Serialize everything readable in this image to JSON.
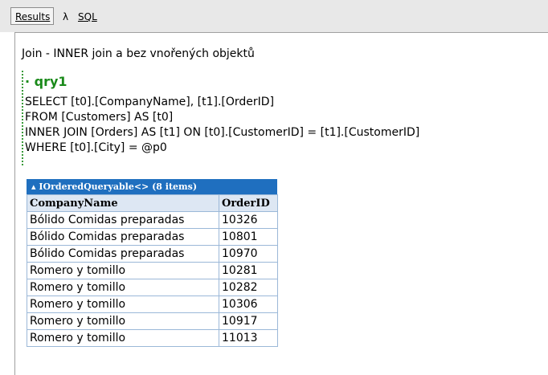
{
  "tabs": {
    "results_label": "Results",
    "lambda_label": "λ",
    "sql_label": "SQL"
  },
  "heading": "Join - INNER join a bez vnořených objektů",
  "query": {
    "name": "qry1",
    "sql_lines": [
      "SELECT [t0].[CompanyName], [t1].[OrderID]",
      "FROM [Customers] AS [t0]",
      "INNER JOIN [Orders] AS [t1] ON [t0].[CustomerID] = [t1].[CustomerID]",
      "WHERE [t0].[City] = @p0"
    ]
  },
  "results": {
    "caption": "IOrderedQueryable<> (8 items)",
    "collapse_icon": "triangle-up-icon",
    "columns": [
      "CompanyName",
      "OrderID"
    ],
    "rows": [
      [
        "Bólido Comidas preparadas",
        "10326"
      ],
      [
        "Bólido Comidas preparadas",
        "10801"
      ],
      [
        "Bólido Comidas preparadas",
        "10970"
      ],
      [
        "Romero y tomillo",
        "10281"
      ],
      [
        "Romero y tomillo",
        "10282"
      ],
      [
        "Romero y tomillo",
        "10306"
      ],
      [
        "Romero y tomillo",
        "10917"
      ],
      [
        "Romero y tomillo",
        "11013"
      ]
    ]
  },
  "colors": {
    "caption_bg": "#1f6fbf",
    "query_name": "#1a8a1a",
    "header_bg": "#dde7f3",
    "cell_border": "#9bb8d8"
  }
}
